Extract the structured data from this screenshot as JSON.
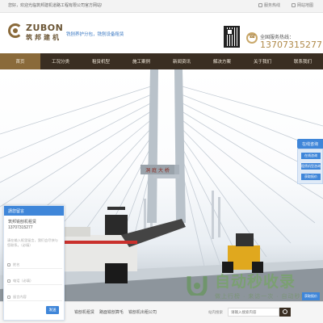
{
  "topbar": {
    "welcome": "您好，欢迎光临筑邦建机道路工程有限公司官方网站!",
    "links": [
      "服务热线",
      "网站地图"
    ]
  },
  "header": {
    "logo_en": "ZUBON",
    "logo_cn": "筑邦建机",
    "slogan": "铣刨养护分包，铣刨设备租赁",
    "hotline_label": "全国服务热线：",
    "hotline_number": "13707315277"
  },
  "nav": [
    "首页",
    "工况分类",
    "租赁机型",
    "施工案例",
    "新闻资讯",
    "解决方案",
    "关于我们",
    "联系我们"
  ],
  "hero": {
    "bridge_sign": "洞 庭 大 桥"
  },
  "chat": {
    "title": "請您留言",
    "message": "筑邦铣刨机租赁13707315277",
    "prompt": "请在输入框里留言，我们会尽快与您联系。（必填）",
    "fields": [
      "姓名",
      "电话（必填）",
      "留言内容"
    ],
    "send": "发送"
  },
  "float": {
    "online": "在线咨询",
    "buttons": [
      "在线咨询",
      "租赁机型咨询",
      "获取报价"
    ]
  },
  "bottombar": {
    "links": [
      "铣刨机租赁",
      "路面铣刨算毛",
      "铣刨机出租公司"
    ],
    "search_label": "站内搜索",
    "search_placeholder": "请输入搜索内容"
  },
  "watermark": {
    "title": "自动秒收录",
    "subtitle": "做上行榜 · 来访一次 · 自动秒收"
  },
  "colors": {
    "brand_brown": "#8a6a3a",
    "nav_dark": "#3a2e22",
    "chat_blue": "#3f86d9"
  }
}
